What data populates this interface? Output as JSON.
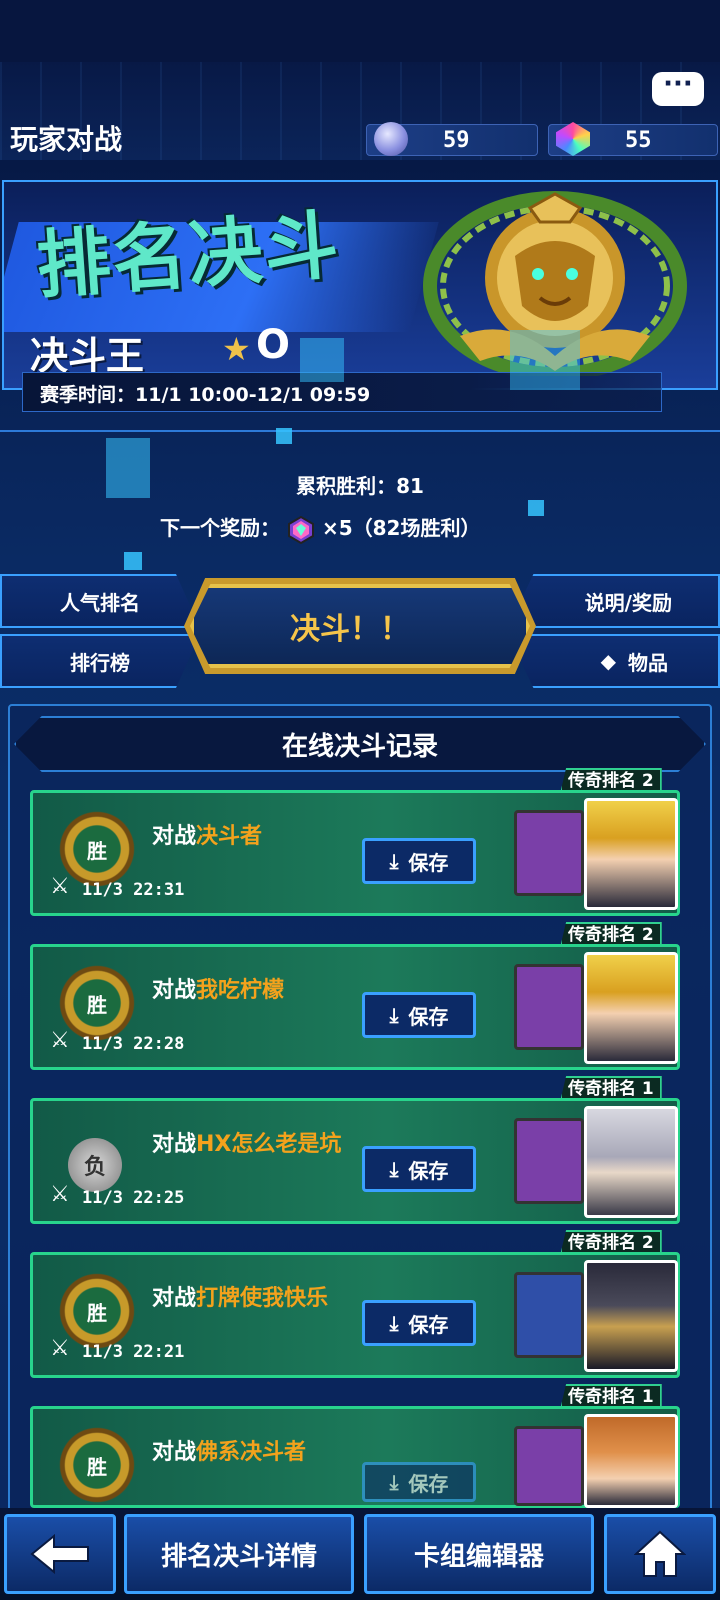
{
  "header": {
    "title": "玩家对战",
    "currencies": [
      {
        "name": "orb",
        "value": "59",
        "color": "#9aa6ff"
      },
      {
        "name": "gem",
        "value": "55",
        "color": "#c060ff"
      }
    ],
    "chat_icon": "chat-bubble-icon"
  },
  "banner": {
    "title": "排名决斗",
    "rank_name": "决斗王",
    "rank_level": "O",
    "season_label": "赛季时间：11/1 10:00-12/1 09:59"
  },
  "stats": {
    "wins_label": "累积胜利：81",
    "reward_prefix": "下一个奖励：",
    "reward_suffix": "×5（82场胜利）"
  },
  "nav": {
    "popular_rank": "人气排名",
    "leaderboard": "排行榜",
    "duel": "决斗！！",
    "rules_rewards": "说明/奖励",
    "items": "物品"
  },
  "records": {
    "header": "在线决斗记录",
    "save_label": "保存",
    "vs_label": "对战",
    "items": [
      {
        "rank": "传奇排名 2",
        "result": "胜",
        "opponent": "决斗者",
        "time": "11/3 22:31",
        "deck_color": "#7a3fa8"
      },
      {
        "rank": "传奇排名 2",
        "result": "胜",
        "opponent": "我吃柠檬",
        "time": "11/3 22:28",
        "deck_color": "#7a3fa8"
      },
      {
        "rank": "传奇排名 1",
        "result": "负",
        "opponent": "HX怎么老是坑",
        "time": "11/3 22:25",
        "deck_color": "#7a3fa8"
      },
      {
        "rank": "传奇排名 2",
        "result": "胜",
        "opponent": "打牌使我快乐",
        "time": "11/3 22:21",
        "deck_color": "#2f4fa8"
      },
      {
        "rank": "传奇排名 1",
        "result": "胜",
        "opponent": "佛系决斗者",
        "time": "",
        "deck_color": "#7a3fa8"
      }
    ]
  },
  "bottom": {
    "back_icon": "back-arrow-icon",
    "details": "排名决斗详情",
    "deck_editor": "卡组编辑器",
    "home_icon": "home-icon"
  }
}
